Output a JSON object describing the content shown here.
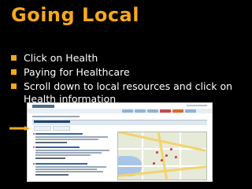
{
  "slide": {
    "title": "Going Local",
    "bullets": [
      "Click on Health",
      "Paying for Healthcare",
      "Scroll down to local resources and click on Health information"
    ]
  },
  "colors": {
    "background": "#000000",
    "title": "#f7a81b",
    "bullet_marker": "#f7a81b",
    "text": "#ffffff",
    "arrow": "#f7a81b"
  },
  "icons": {
    "bullet": "square-bullet-icon",
    "arrow": "arrow-right-icon"
  }
}
